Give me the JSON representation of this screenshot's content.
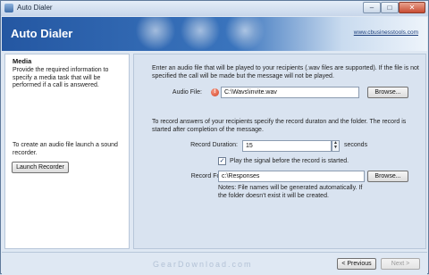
{
  "window": {
    "title": "Auto Dialer"
  },
  "banner": {
    "title": "Auto Dialer",
    "link": "www.cbusinesstools.com"
  },
  "left": {
    "heading": "Media",
    "description": "Provide the required information to specify a media task that will be performed if a call is answered.",
    "hint": "To create an audio file launch a sound recorder.",
    "launch_button": "Launch Recorder"
  },
  "right": {
    "audio_intro": "Enter an audio file that will be played to your recipients (.wav files are supported). If the file is not specified the call will be made but the message will not be played.",
    "audio_label": "Audio File:",
    "audio_value": "C:\\Wavs\\invite.wav",
    "browse1": "Browse...",
    "record_intro": "To record answers of your recipients specify the record duraton and the folder. The record is started after completion of the message.",
    "duration_label": "Record Duration:",
    "duration_value": "15",
    "duration_unit": "seconds",
    "signal_label": "Play the signal before the record is started.",
    "signal_checked": true,
    "folder_label": "Record Folder:",
    "folder_value": "c:\\Responses",
    "browse2": "Browse...",
    "notes": "Notes: File names will be generated automatically. If the folder doesn't exist it will be created."
  },
  "footer": {
    "previous": "< Previous",
    "next": "Next >"
  },
  "watermark": "GearDownload.com",
  "colors": {
    "banner": "#2457a2",
    "error": "#d23b1c"
  }
}
